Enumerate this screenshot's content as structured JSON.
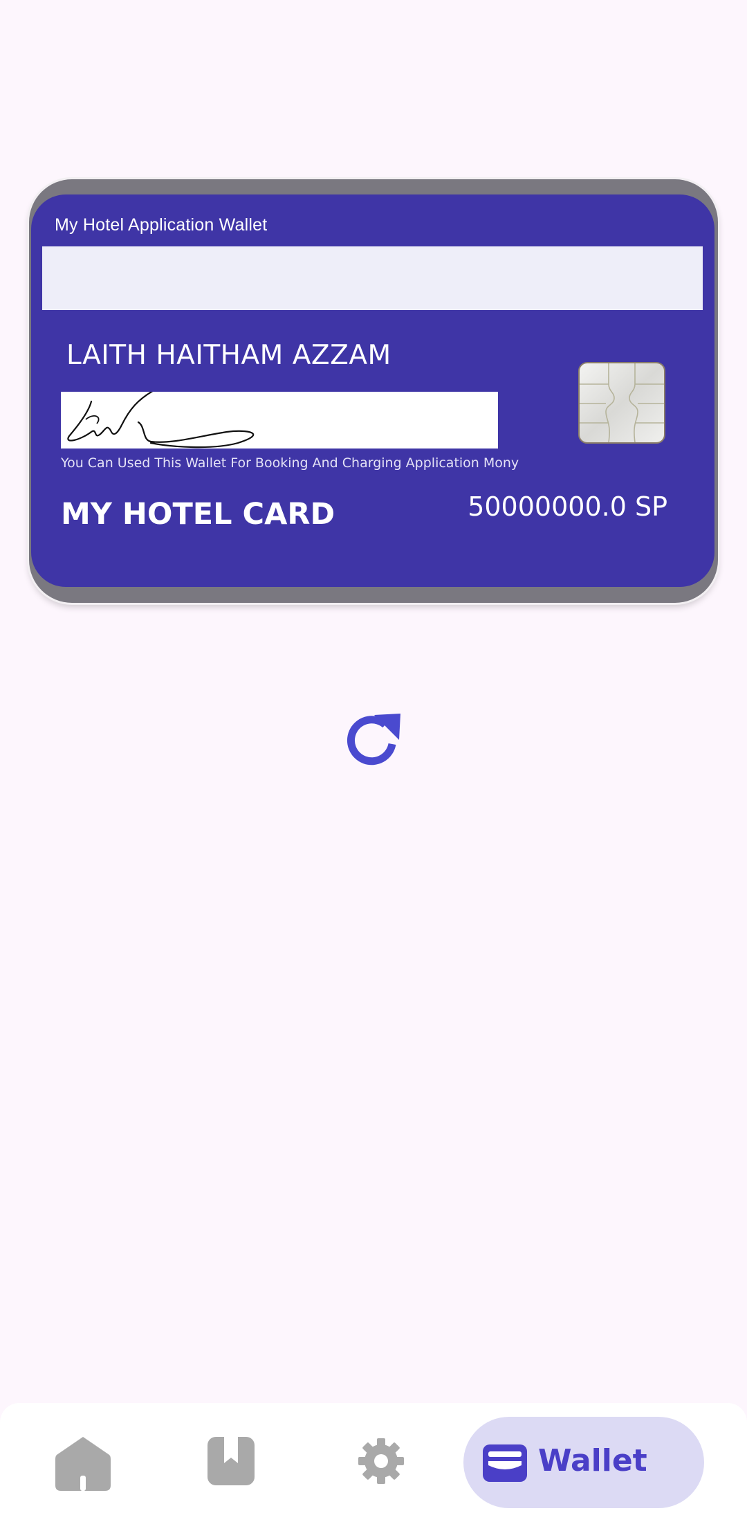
{
  "card": {
    "header": "My Hotel Application Wallet",
    "holder_name": "LAITH HAITHAM AZZAM",
    "note": "You Can Used This Wallet For Booking And Charging Application Mony",
    "brand": "MY HOTEL CARD",
    "balance": "50000000.0 SP"
  },
  "actions": {
    "refresh_icon": "refresh-icon"
  },
  "bottom_nav": {
    "items": [
      {
        "icon": "home-icon",
        "label": ""
      },
      {
        "icon": "bookmark-icon",
        "label": ""
      },
      {
        "icon": "gear-icon",
        "label": ""
      },
      {
        "icon": "wallet-icon",
        "label": "Wallet",
        "selected": true
      }
    ]
  },
  "colors": {
    "card_bg": "#3f35a6",
    "accent": "#4a3fc7",
    "page_bg": "#fdf6fd",
    "nav_selected_bg": "#dcdaf4"
  }
}
